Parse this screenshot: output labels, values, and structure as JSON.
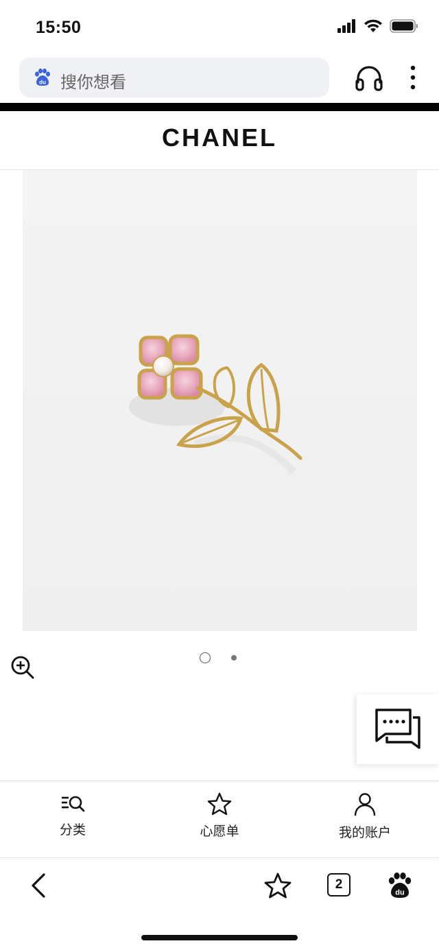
{
  "status_bar": {
    "time": "15:50",
    "icons": [
      "cellular-signal-icon",
      "wifi-icon",
      "battery-icon"
    ]
  },
  "browser": {
    "search_placeholder": "搜你想看",
    "icons": [
      "baidu-paw-icon",
      "headphones-icon",
      "more-vertical-icon"
    ]
  },
  "site": {
    "brand": "CHANEL"
  },
  "product": {
    "image_description_icon": "flower-brooch-image",
    "carousel_total": 2,
    "carousel_current": 1
  },
  "site_nav": {
    "items": [
      {
        "label": "分类",
        "icon": "category-search-icon"
      },
      {
        "label": "心愿单",
        "icon": "star-outline-icon"
      },
      {
        "label": "我的账户",
        "icon": "user-icon"
      }
    ]
  },
  "toolbar": {
    "tab_count": "2",
    "icons": [
      "back-arrow-icon",
      "star-outline-icon",
      "tabs-icon",
      "baidu-paw-icon"
    ]
  },
  "colors": {
    "search_bg": "#f0f1f4",
    "baidu_blue": "#3a63d8",
    "product_bg": "#f2f2f2",
    "gold": "#c9a24a",
    "pink_stone": "#e8a8bd"
  }
}
